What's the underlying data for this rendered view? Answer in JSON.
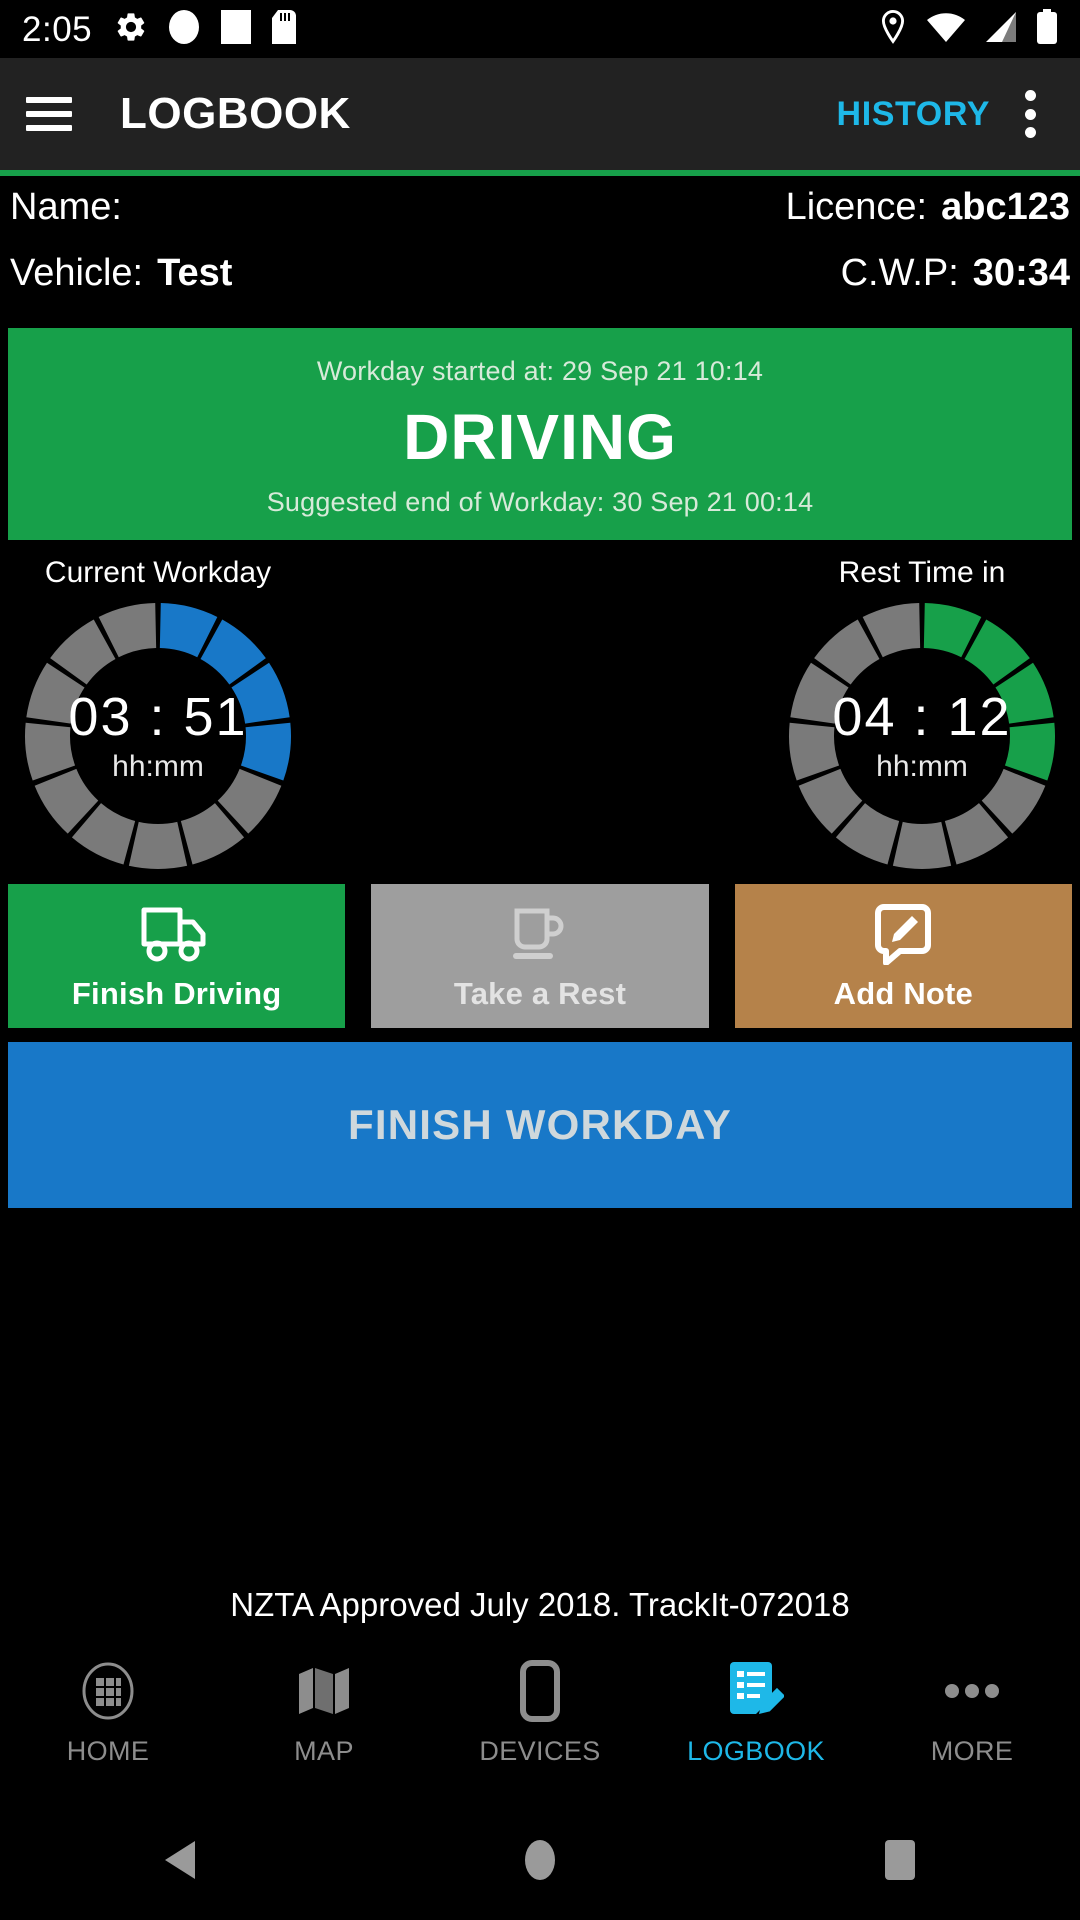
{
  "statusbar": {
    "clock": "2:05",
    "left_icons": [
      "settings-gear-icon",
      "circle-icon",
      "square-icon",
      "sd-card-icon"
    ],
    "right_icons": [
      "location-pin-icon",
      "wifi-icon",
      "cell-signal-icon",
      "battery-icon"
    ]
  },
  "appbar": {
    "menu_icon": "hamburger-menu-icon",
    "title": "LOGBOOK",
    "history_label": "HISTORY",
    "overflow_icon": "kebab-overflow-icon",
    "accent_color": "#17a04a",
    "history_color": "#1eb8e8"
  },
  "info": {
    "name_label": "Name:",
    "name_value": "",
    "licence_label": "Licence:",
    "licence_value": "abc123",
    "vehicle_label": "Vehicle:",
    "vehicle_value": "Test",
    "cwp_label": "C.W.P:",
    "cwp_value": "30:34"
  },
  "status_panel": {
    "started_text": "Workday started at: 29 Sep 21 10:14",
    "state": "DRIVING",
    "suggested_end_text": "Suggested end of Workday: 30 Sep 21 00:14",
    "background_color": "#17a04a"
  },
  "gauges": [
    {
      "title": "Current Workday",
      "time": "03 : 51",
      "unit": "hh:mm",
      "fill_color": "#1878c8",
      "track_color": "#7a7a7a",
      "segments_total": 13,
      "segments_filled": 4
    },
    {
      "title": "Rest Time in",
      "time": "04 : 12",
      "unit": "hh:mm",
      "fill_color": "#17a04a",
      "track_color": "#7a7a7a",
      "segments_total": 13,
      "segments_filled": 4
    }
  ],
  "actions": [
    {
      "label": "Finish Driving",
      "icon": "truck-icon",
      "color": "#17a04a"
    },
    {
      "label": "Take a Rest",
      "icon": "coffee-cup-icon",
      "color": "#9e9e9e"
    },
    {
      "label": "Add Note",
      "icon": "note-pencil-icon",
      "color": "#b5824a"
    }
  ],
  "finish_workday": {
    "label": "FINISH WORKDAY",
    "color": "#1878c8"
  },
  "footer": {
    "note": "NZTA Approved July 2018. TrackIt-072018"
  },
  "bottomnav": {
    "active_color": "#1eb8e8",
    "items": [
      {
        "label": "HOME",
        "icon": "grid-home-icon",
        "active": false
      },
      {
        "label": "MAP",
        "icon": "map-icon",
        "active": false
      },
      {
        "label": "DEVICES",
        "icon": "device-icon",
        "active": false
      },
      {
        "label": "LOGBOOK",
        "icon": "logbook-icon",
        "active": true
      },
      {
        "label": "MORE",
        "icon": "more-dots-icon",
        "active": false
      }
    ]
  },
  "sysnav": {
    "back_icon": "back-triangle-icon",
    "home_icon": "home-circle-icon",
    "recents_icon": "recents-square-icon"
  }
}
